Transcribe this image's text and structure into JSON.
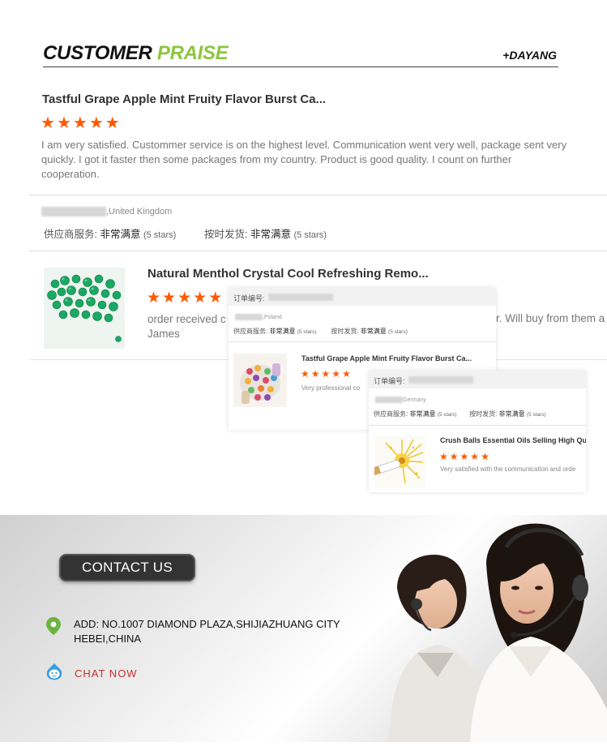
{
  "header": {
    "title_word1": "CUSTOMER",
    "title_word2": "PRAISE",
    "brand": "+DAYANG"
  },
  "review1": {
    "title": "Tastful Grape Apple Mint Fruity Flavor Burst Ca...",
    "rating": 5,
    "text": "I am very satisfied. Custommer service is on the highest level. Communication went very well, package sent very quickly. I got it faster then some packages from my country. Product is good quality. I count on further cooperation."
  },
  "info": {
    "country": ",United Kingdom",
    "service_label": "供应商服务:",
    "service_value": "非常满意",
    "service_stars": "(5 stars)",
    "shipping_label": "按时发货:",
    "shipping_value": "非常满意",
    "shipping_stars": "(5 stars)"
  },
  "review2": {
    "title": "Natural Menthol Crystal Cool Refreshing Remo...",
    "rating": 5,
    "text_line1": "order received c",
    "text_line2": "James",
    "text_tail": "r. Will buy from them a"
  },
  "card2": {
    "order_label": "订单编号:",
    "country": ",Poland",
    "service_label": "供应商服务:",
    "service_value": "非常满意",
    "service_stars": "(5 stars)",
    "shipping_label": "按时发货:",
    "shipping_value": "非常满意",
    "shipping_stars": "(5 stars)",
    "title": "Tastful Grape Apple Mint Fruity Flavor Burst Ca...",
    "rating": 5,
    "text": "Very professional co"
  },
  "card3": {
    "order_label": "订单编号:",
    "country": "Germany",
    "service_label": "供应商服务:",
    "service_value": "非常满意",
    "service_stars": "(5 stars)",
    "shipping_label": "按时发货:",
    "shipping_value": "非常满意",
    "shipping_stars": "(5 stars)",
    "title": "Crush Balls Essential Oils Selling High Qu",
    "rating": 5,
    "text": "Very satisfied with the communication and orde"
  },
  "contact": {
    "button_label": "CONTACT US",
    "address_line1": "ADD: NO.1007 DIAMOND PLAZA,SHIJIAZHUANG CITY",
    "address_line2": "HEBEI,CHINA",
    "chat_label": "CHAT NOW",
    "icons": [
      "location-pin-icon",
      "chat-bubble-icon",
      "star-icon"
    ]
  },
  "colors": {
    "accent_green": "#8dc63f",
    "star_orange": "#ff5a00",
    "chat_red": "#c9302c",
    "pin_green": "#6cb33f",
    "chat_blue": "#3aa0e0"
  }
}
